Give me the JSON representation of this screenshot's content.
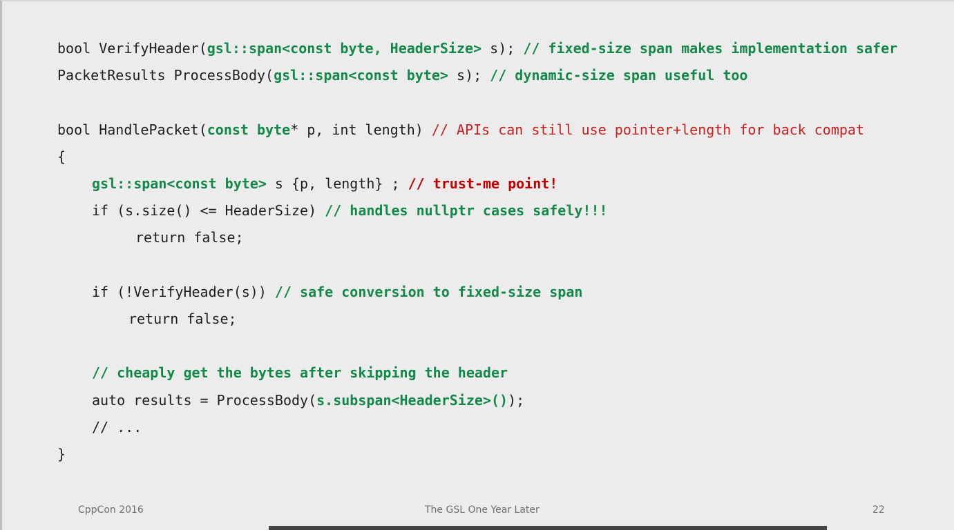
{
  "code_lines": [
    {
      "indent": 0,
      "segments": [
        {
          "t": "bool VerifyHeader(",
          "c": "plain"
        },
        {
          "t": "gsl::span<const byte, HeaderSize>",
          "c": "green"
        },
        {
          "t": " s); ",
          "c": "plain"
        },
        {
          "t": "// fixed-size span makes implementation safer",
          "c": "green"
        }
      ]
    },
    {
      "indent": 0,
      "segments": [
        {
          "t": "PacketResults ProcessBody(",
          "c": "plain"
        },
        {
          "t": "gsl::span<const byte>",
          "c": "green"
        },
        {
          "t": " s); ",
          "c": "plain"
        },
        {
          "t": "// dynamic-size span useful too",
          "c": "green"
        }
      ]
    },
    {
      "indent": 0,
      "segments": []
    },
    {
      "indent": 0,
      "segments": [
        {
          "t": "bool HandlePacket(",
          "c": "plain"
        },
        {
          "t": "const byte",
          "c": "green"
        },
        {
          "t": "* p, int length) ",
          "c": "plain"
        },
        {
          "t": "// APIs can still use pointer+length for back compat",
          "c": "red"
        }
      ]
    },
    {
      "indent": 0,
      "segments": [
        {
          "t": "{",
          "c": "plain"
        }
      ]
    },
    {
      "indent": 1,
      "segments": [
        {
          "t": "gsl::span<const byte>",
          "c": "green"
        },
        {
          "t": " s {p, length} ; ",
          "c": "plain"
        },
        {
          "t": "// trust-me point!",
          "c": "redb"
        }
      ]
    },
    {
      "indent": 1,
      "segments": [
        {
          "t": "if (s.size() <= HeaderSize) ",
          "c": "plain"
        },
        {
          "t": "// handles nullptr cases safely!!!",
          "c": "green"
        }
      ]
    },
    {
      "indent": 2,
      "segments": [
        {
          "t": "return false;",
          "c": "plain"
        }
      ]
    },
    {
      "indent": 0,
      "segments": []
    },
    {
      "indent": 1,
      "segments": [
        {
          "t": "if (!VerifyHeader(s)) ",
          "c": "plain"
        },
        {
          "t": "// safe conversion to fixed-size span",
          "c": "green"
        }
      ]
    },
    {
      "indent": 3,
      "segments": [
        {
          "t": "return false;",
          "c": "plain"
        }
      ]
    },
    {
      "indent": 0,
      "segments": []
    },
    {
      "indent": 1,
      "segments": [
        {
          "t": "// cheaply get the bytes after skipping the header",
          "c": "green"
        }
      ]
    },
    {
      "indent": 1,
      "segments": [
        {
          "t": "auto results = ProcessBody(",
          "c": "plain"
        },
        {
          "t": "s.subspan<HeaderSize>()",
          "c": "green"
        },
        {
          "t": ");",
          "c": "plain"
        }
      ]
    },
    {
      "indent": 1,
      "segments": [
        {
          "t": "// ...",
          "c": "plain"
        }
      ]
    },
    {
      "indent": 0,
      "segments": [
        {
          "t": "}",
          "c": "plain"
        }
      ]
    }
  ],
  "footer": {
    "left": "CppCon 2016",
    "center": "The GSL One Year Later",
    "right": "22"
  },
  "video_progress_bar": {
    "color": "#444444"
  },
  "colors": {
    "background": "#ececec",
    "plain": "#1e1e1e",
    "green": "#13884a",
    "red": "#cc1f1f",
    "footer_text": "#6e6e6e"
  }
}
